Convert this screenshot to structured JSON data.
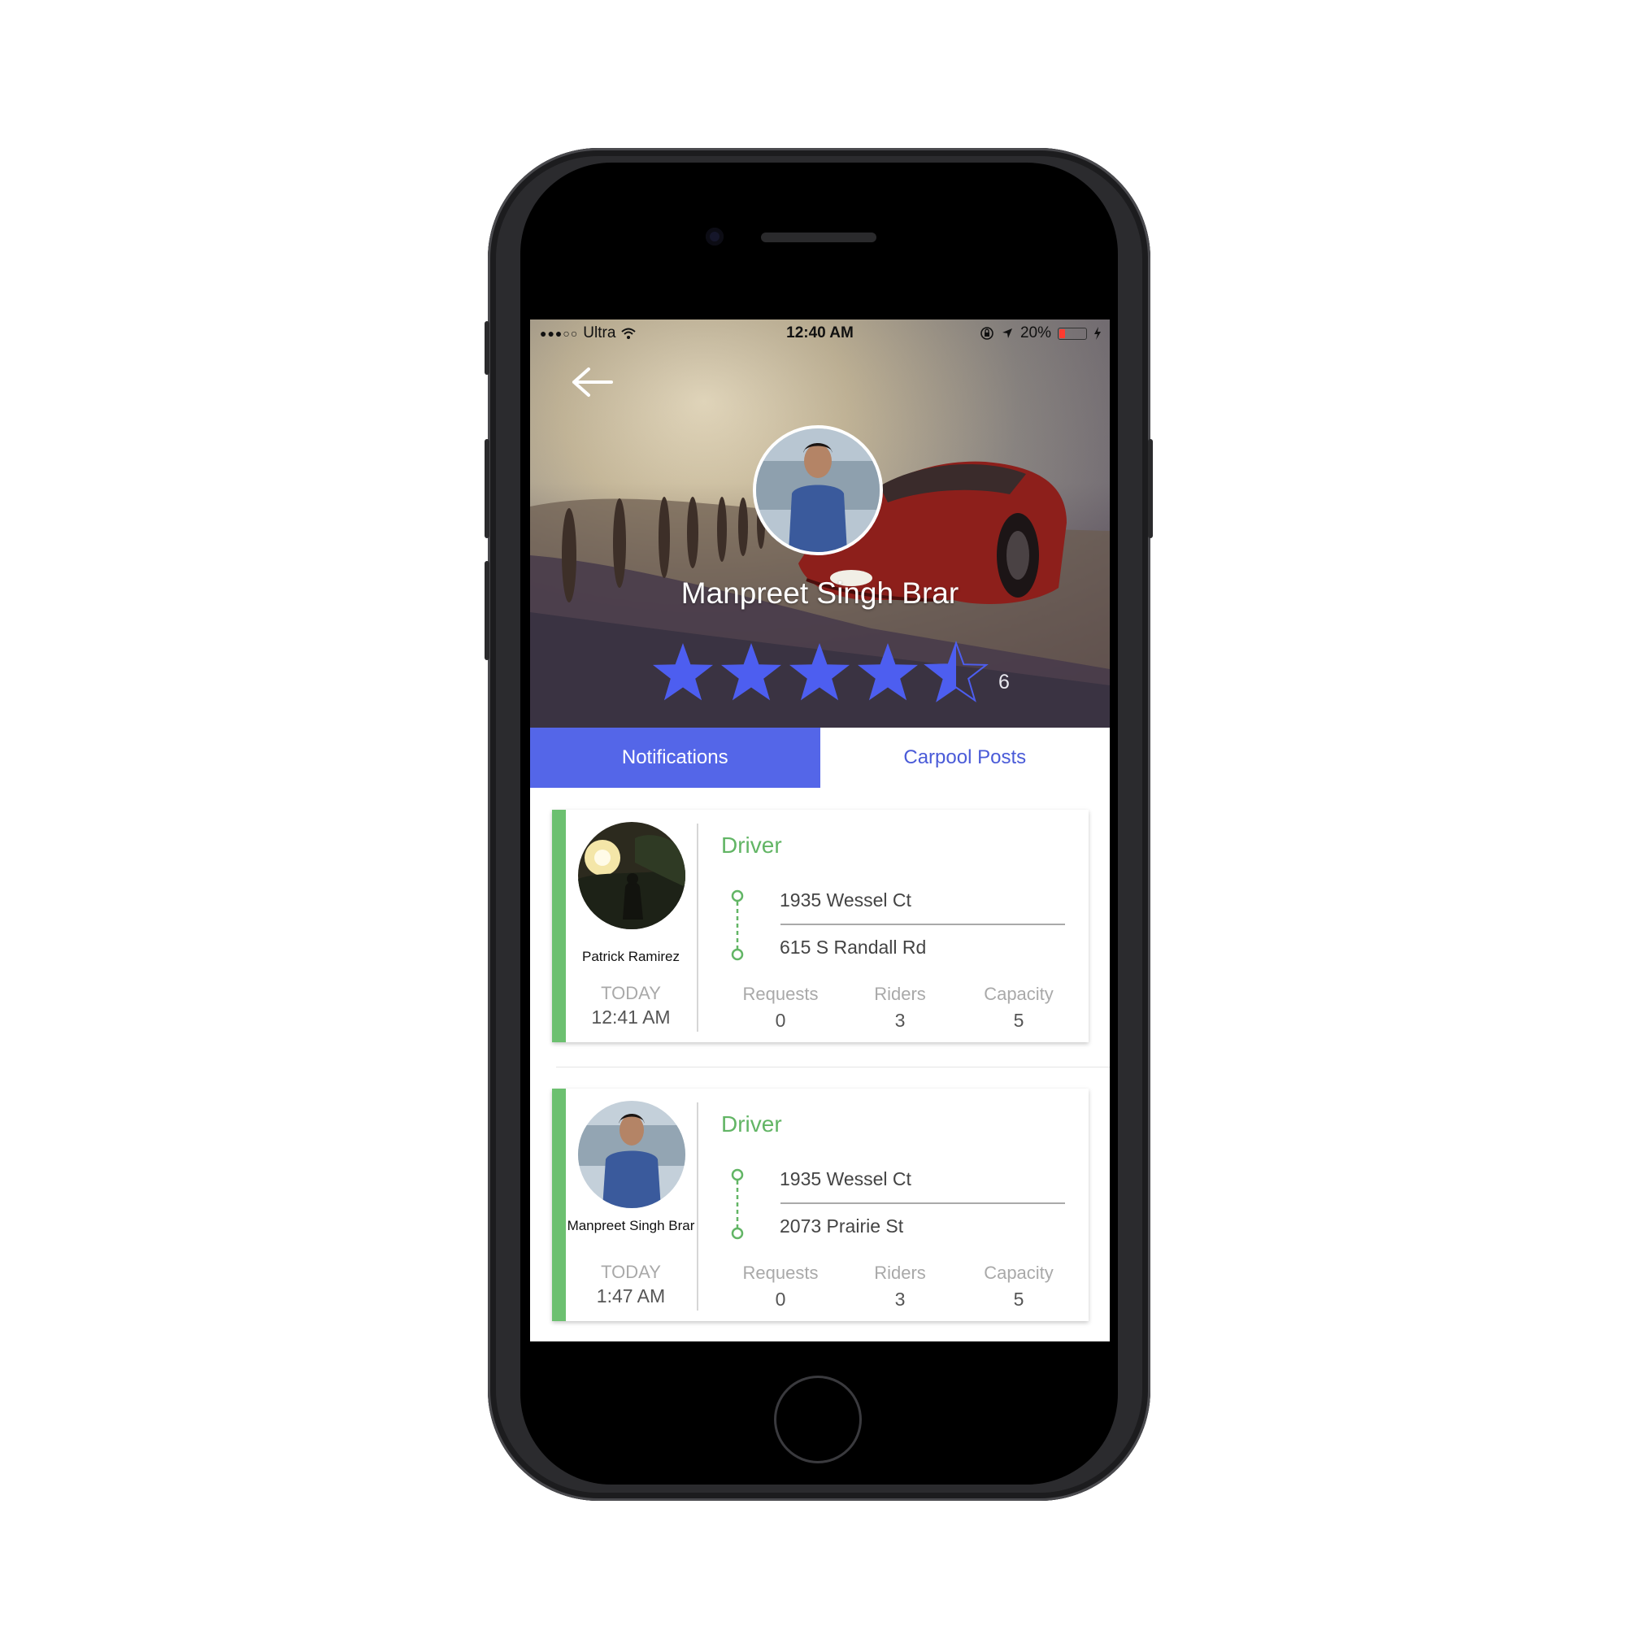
{
  "status_bar": {
    "signal": "●●●○○",
    "carrier": "Ultra",
    "time": "12:40 AM",
    "battery": "20%",
    "battery_level": 0.2
  },
  "profile": {
    "name": "Manpreet Singh Brar",
    "rating": 4.5,
    "rating_max": 5,
    "rating_count": "6"
  },
  "tabs": [
    {
      "label": "Notifications",
      "active": true
    },
    {
      "label": "Carpool Posts",
      "active": false
    }
  ],
  "posts": [
    {
      "person": "Patrick Ramirez",
      "day": "TODAY",
      "time": "12:41 AM",
      "role": "Driver",
      "from": "1935 Wessel Ct",
      "to": "615 S Randall Rd",
      "stats": [
        {
          "label": "Requests",
          "value": "0"
        },
        {
          "label": "Riders",
          "value": "3"
        },
        {
          "label": "Capacity",
          "value": "5"
        }
      ]
    },
    {
      "person": "Manpreet Singh Brar",
      "day": "TODAY",
      "time": "1:47 AM",
      "role": "Driver",
      "from": "1935 Wessel Ct",
      "to": "2073 Prairie St",
      "stats": [
        {
          "label": "Requests",
          "value": "0"
        },
        {
          "label": "Riders",
          "value": "3"
        },
        {
          "label": "Capacity",
          "value": "5"
        }
      ]
    }
  ],
  "colors": {
    "accent_blue": "#5466e8",
    "accent_green": "#6cc070",
    "star_blue": "#4d5ef0"
  }
}
